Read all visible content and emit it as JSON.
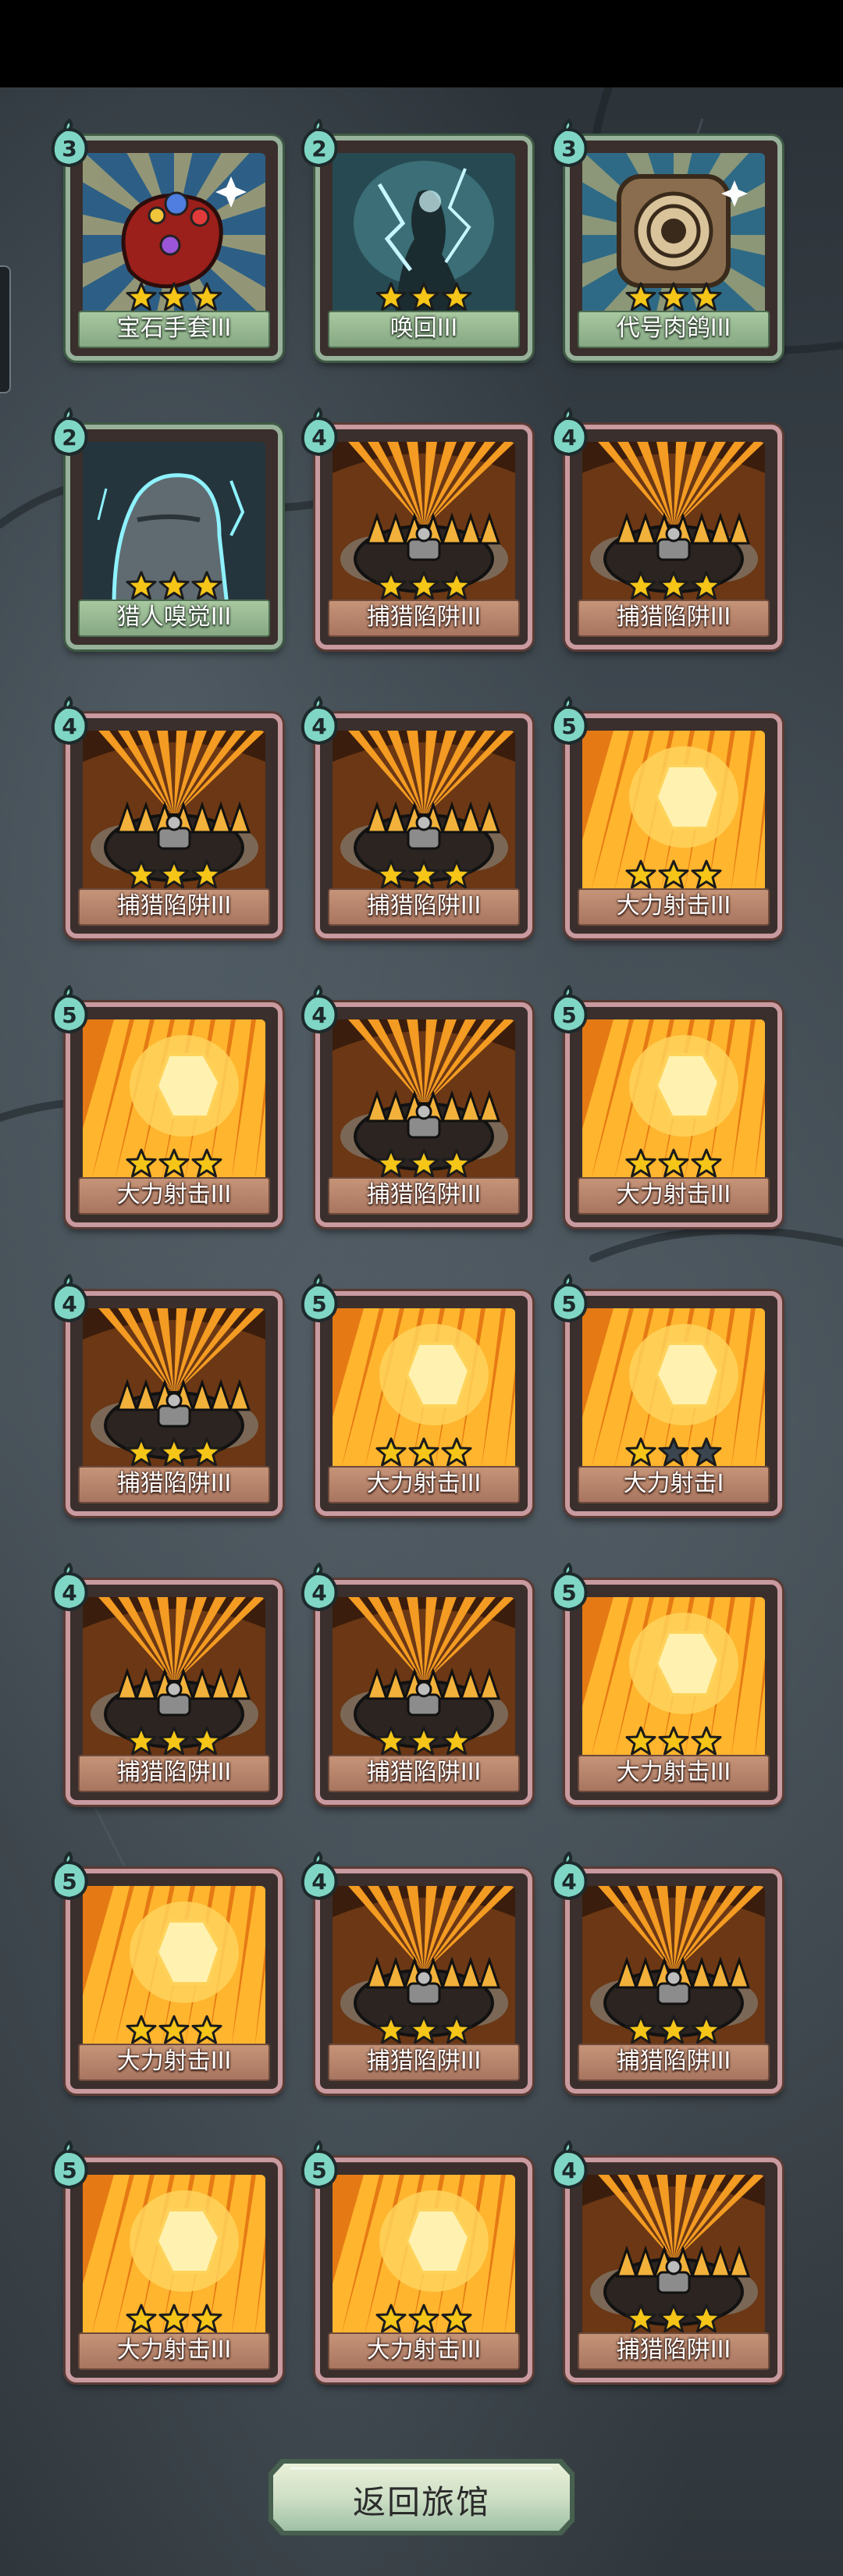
{
  "return_button": {
    "label": "返回旅馆"
  },
  "cards": [
    {
      "name": "宝石手套III",
      "cost": "3",
      "art": "gauntlet",
      "frame": "green",
      "stars": 3
    },
    {
      "name": "唤回III",
      "cost": "2",
      "art": "recall",
      "frame": "green",
      "stars": 3
    },
    {
      "name": "代号肉鸽III",
      "cost": "3",
      "art": "roguelike",
      "frame": "green",
      "stars": 3
    },
    {
      "name": "猎人嗅觉III",
      "cost": "2",
      "art": "hunter",
      "frame": "green",
      "stars": 3
    },
    {
      "name": "捕猎陷阱III",
      "cost": "4",
      "art": "trap",
      "frame": "red",
      "stars": 3
    },
    {
      "name": "捕猎陷阱III",
      "cost": "4",
      "art": "trap",
      "frame": "red",
      "stars": 3
    },
    {
      "name": "捕猎陷阱III",
      "cost": "4",
      "art": "trap",
      "frame": "red",
      "stars": 3
    },
    {
      "name": "捕猎陷阱III",
      "cost": "4",
      "art": "trap",
      "frame": "red",
      "stars": 3
    },
    {
      "name": "大力射击III",
      "cost": "5",
      "art": "shot",
      "frame": "red",
      "stars": 3
    },
    {
      "name": "大力射击III",
      "cost": "5",
      "art": "shot",
      "frame": "red",
      "stars": 3
    },
    {
      "name": "捕猎陷阱III",
      "cost": "4",
      "art": "trap",
      "frame": "red",
      "stars": 3
    },
    {
      "name": "大力射击III",
      "cost": "5",
      "art": "shot",
      "frame": "red",
      "stars": 3
    },
    {
      "name": "捕猎陷阱III",
      "cost": "4",
      "art": "trap",
      "frame": "red",
      "stars": 3
    },
    {
      "name": "大力射击III",
      "cost": "5",
      "art": "shot",
      "frame": "red",
      "stars": 3
    },
    {
      "name": "大力射击I",
      "cost": "5",
      "art": "shot",
      "frame": "red",
      "stars": 1
    },
    {
      "name": "捕猎陷阱III",
      "cost": "4",
      "art": "trap",
      "frame": "red",
      "stars": 3
    },
    {
      "name": "捕猎陷阱III",
      "cost": "4",
      "art": "trap",
      "frame": "red",
      "stars": 3
    },
    {
      "name": "大力射击III",
      "cost": "5",
      "art": "shot",
      "frame": "red",
      "stars": 3
    },
    {
      "name": "大力射击III",
      "cost": "5",
      "art": "shot",
      "frame": "red",
      "stars": 3
    },
    {
      "name": "捕猎陷阱III",
      "cost": "4",
      "art": "trap",
      "frame": "red",
      "stars": 3
    },
    {
      "name": "捕猎陷阱III",
      "cost": "4",
      "art": "trap",
      "frame": "red",
      "stars": 3
    },
    {
      "name": "大力射击III",
      "cost": "5",
      "art": "shot",
      "frame": "red",
      "stars": 3
    },
    {
      "name": "大力射击III",
      "cost": "5",
      "art": "shot",
      "frame": "red",
      "stars": 3
    },
    {
      "name": "捕猎陷阱III",
      "cost": "4",
      "art": "trap",
      "frame": "red",
      "stars": 3
    }
  ],
  "colors": {
    "star_filled": "#f5c518",
    "star_empty": "#3a4550",
    "cost_badge": "#7fd6c4",
    "frame_green": "#97b19a",
    "frame_red": "#c99aa0"
  }
}
